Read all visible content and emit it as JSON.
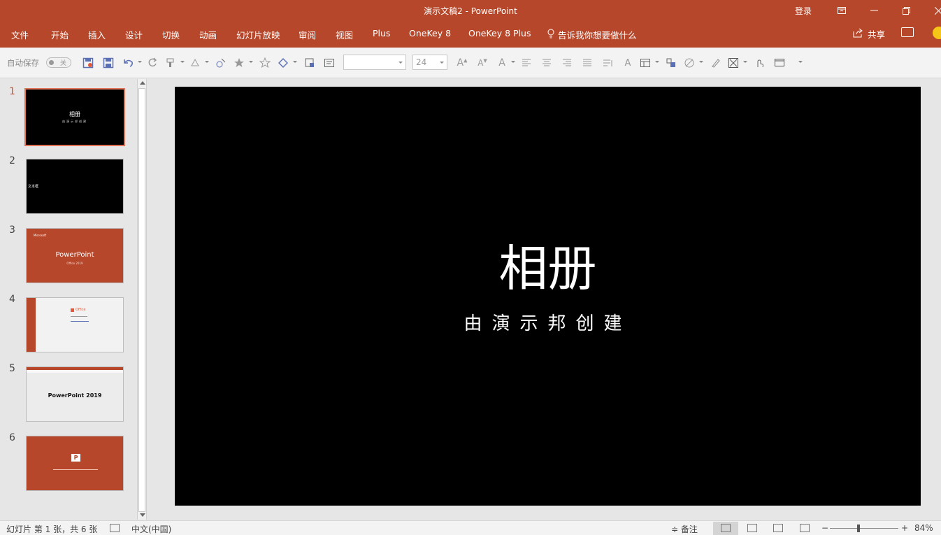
{
  "window": {
    "title": "演示文稿2  -  PowerPoint",
    "login": "登录",
    "controls": [
      "ribbon-display-icon",
      "minimize-icon",
      "restore-icon",
      "close-icon"
    ]
  },
  "ribbon": {
    "tabs": [
      "文件",
      "开始",
      "插入",
      "设计",
      "切换",
      "动画",
      "幻灯片放映",
      "审阅",
      "视图",
      "Plus",
      "OneKey 8",
      "OneKey 8 Plus"
    ],
    "tell_me": "告诉我你想要做什么",
    "share": "共享"
  },
  "toolbar": {
    "autosave_label": "自动保存",
    "autosave_state": "关",
    "font_name": "",
    "font_size": "24"
  },
  "thumbnails": [
    {
      "number": "1",
      "title": "相册",
      "subtitle": "由演示邦创建"
    },
    {
      "number": "2",
      "title": "文本框"
    },
    {
      "number": "3",
      "brand": "Microsoft",
      "title": "PowerPoint",
      "subtitle": "Office 2019"
    },
    {
      "number": "4",
      "title": "Office"
    },
    {
      "number": "5",
      "title": "PowerPoint 2019"
    },
    {
      "number": "6",
      "title": "P"
    }
  ],
  "slide": {
    "title": "相册",
    "subtitle": "由演示邦创建"
  },
  "status": {
    "slide_info": "幻灯片 第 1 张，共 6 张",
    "language": "中文(中国)",
    "notes": "备注",
    "zoom": "84%",
    "zoom_fraction": 0.42
  },
  "colors": {
    "accent": "#b7472a",
    "selected_thumb": "#e07355"
  }
}
